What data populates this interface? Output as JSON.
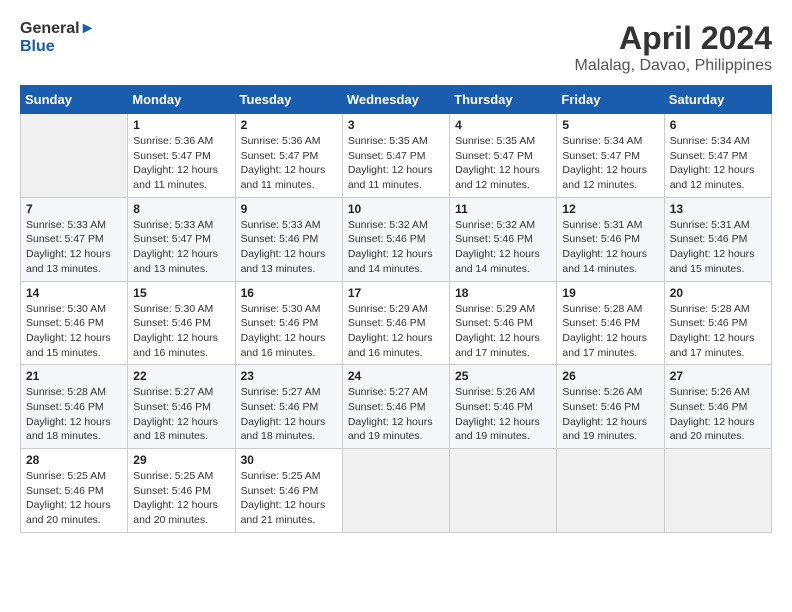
{
  "header": {
    "logo_line1": "General",
    "logo_line2": "Blue",
    "month": "April 2024",
    "location": "Malalag, Davao, Philippines"
  },
  "days_of_week": [
    "Sunday",
    "Monday",
    "Tuesday",
    "Wednesday",
    "Thursday",
    "Friday",
    "Saturday"
  ],
  "weeks": [
    [
      {
        "day": "",
        "info": ""
      },
      {
        "day": "1",
        "info": "Sunrise: 5:36 AM\nSunset: 5:47 PM\nDaylight: 12 hours\nand 11 minutes."
      },
      {
        "day": "2",
        "info": "Sunrise: 5:36 AM\nSunset: 5:47 PM\nDaylight: 12 hours\nand 11 minutes."
      },
      {
        "day": "3",
        "info": "Sunrise: 5:35 AM\nSunset: 5:47 PM\nDaylight: 12 hours\nand 11 minutes."
      },
      {
        "day": "4",
        "info": "Sunrise: 5:35 AM\nSunset: 5:47 PM\nDaylight: 12 hours\nand 12 minutes."
      },
      {
        "day": "5",
        "info": "Sunrise: 5:34 AM\nSunset: 5:47 PM\nDaylight: 12 hours\nand 12 minutes."
      },
      {
        "day": "6",
        "info": "Sunrise: 5:34 AM\nSunset: 5:47 PM\nDaylight: 12 hours\nand 12 minutes."
      }
    ],
    [
      {
        "day": "7",
        "info": "Sunrise: 5:33 AM\nSunset: 5:47 PM\nDaylight: 12 hours\nand 13 minutes."
      },
      {
        "day": "8",
        "info": "Sunrise: 5:33 AM\nSunset: 5:47 PM\nDaylight: 12 hours\nand 13 minutes."
      },
      {
        "day": "9",
        "info": "Sunrise: 5:33 AM\nSunset: 5:46 PM\nDaylight: 12 hours\nand 13 minutes."
      },
      {
        "day": "10",
        "info": "Sunrise: 5:32 AM\nSunset: 5:46 PM\nDaylight: 12 hours\nand 14 minutes."
      },
      {
        "day": "11",
        "info": "Sunrise: 5:32 AM\nSunset: 5:46 PM\nDaylight: 12 hours\nand 14 minutes."
      },
      {
        "day": "12",
        "info": "Sunrise: 5:31 AM\nSunset: 5:46 PM\nDaylight: 12 hours\nand 14 minutes."
      },
      {
        "day": "13",
        "info": "Sunrise: 5:31 AM\nSunset: 5:46 PM\nDaylight: 12 hours\nand 15 minutes."
      }
    ],
    [
      {
        "day": "14",
        "info": "Sunrise: 5:30 AM\nSunset: 5:46 PM\nDaylight: 12 hours\nand 15 minutes."
      },
      {
        "day": "15",
        "info": "Sunrise: 5:30 AM\nSunset: 5:46 PM\nDaylight: 12 hours\nand 16 minutes."
      },
      {
        "day": "16",
        "info": "Sunrise: 5:30 AM\nSunset: 5:46 PM\nDaylight: 12 hours\nand 16 minutes."
      },
      {
        "day": "17",
        "info": "Sunrise: 5:29 AM\nSunset: 5:46 PM\nDaylight: 12 hours\nand 16 minutes."
      },
      {
        "day": "18",
        "info": "Sunrise: 5:29 AM\nSunset: 5:46 PM\nDaylight: 12 hours\nand 17 minutes."
      },
      {
        "day": "19",
        "info": "Sunrise: 5:28 AM\nSunset: 5:46 PM\nDaylight: 12 hours\nand 17 minutes."
      },
      {
        "day": "20",
        "info": "Sunrise: 5:28 AM\nSunset: 5:46 PM\nDaylight: 12 hours\nand 17 minutes."
      }
    ],
    [
      {
        "day": "21",
        "info": "Sunrise: 5:28 AM\nSunset: 5:46 PM\nDaylight: 12 hours\nand 18 minutes."
      },
      {
        "day": "22",
        "info": "Sunrise: 5:27 AM\nSunset: 5:46 PM\nDaylight: 12 hours\nand 18 minutes."
      },
      {
        "day": "23",
        "info": "Sunrise: 5:27 AM\nSunset: 5:46 PM\nDaylight: 12 hours\nand 18 minutes."
      },
      {
        "day": "24",
        "info": "Sunrise: 5:27 AM\nSunset: 5:46 PM\nDaylight: 12 hours\nand 19 minutes."
      },
      {
        "day": "25",
        "info": "Sunrise: 5:26 AM\nSunset: 5:46 PM\nDaylight: 12 hours\nand 19 minutes."
      },
      {
        "day": "26",
        "info": "Sunrise: 5:26 AM\nSunset: 5:46 PM\nDaylight: 12 hours\nand 19 minutes."
      },
      {
        "day": "27",
        "info": "Sunrise: 5:26 AM\nSunset: 5:46 PM\nDaylight: 12 hours\nand 20 minutes."
      }
    ],
    [
      {
        "day": "28",
        "info": "Sunrise: 5:25 AM\nSunset: 5:46 PM\nDaylight: 12 hours\nand 20 minutes."
      },
      {
        "day": "29",
        "info": "Sunrise: 5:25 AM\nSunset: 5:46 PM\nDaylight: 12 hours\nand 20 minutes."
      },
      {
        "day": "30",
        "info": "Sunrise: 5:25 AM\nSunset: 5:46 PM\nDaylight: 12 hours\nand 21 minutes."
      },
      {
        "day": "",
        "info": ""
      },
      {
        "day": "",
        "info": ""
      },
      {
        "day": "",
        "info": ""
      },
      {
        "day": "",
        "info": ""
      }
    ]
  ]
}
